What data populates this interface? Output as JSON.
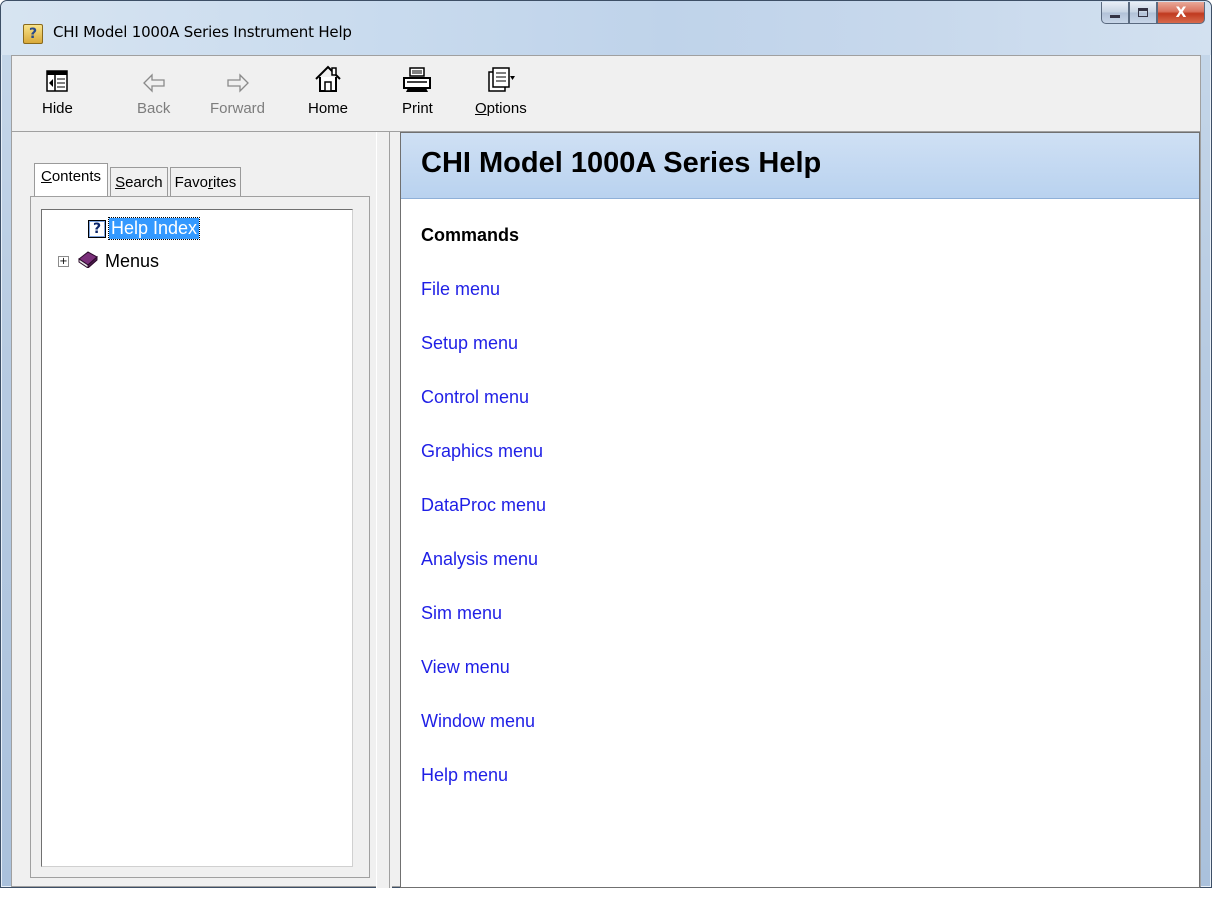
{
  "window": {
    "title": "CHI Model 1000A Series Instrument Help",
    "title_icon": "help-book-icon",
    "caption_buttons": [
      "minimize",
      "maximize",
      "close"
    ],
    "close_glyph": "X"
  },
  "toolbar": {
    "items": [
      {
        "label": "Hide",
        "icon": "hide-pane-icon",
        "enabled": true
      },
      {
        "label": "Back",
        "icon": "back-arrow-icon",
        "enabled": false
      },
      {
        "label": "Forward",
        "icon": "forward-arrow-icon",
        "enabled": false
      },
      {
        "label": "Home",
        "icon": "home-icon",
        "enabled": true
      },
      {
        "label": "Print",
        "icon": "printer-icon",
        "enabled": true
      },
      {
        "label": "Options",
        "icon": "options-icon",
        "enabled": true
      }
    ]
  },
  "nav": {
    "tabs": [
      {
        "label_pre": "",
        "accel": "C",
        "label_post": "ontents",
        "active": true
      },
      {
        "label_pre": "",
        "accel": "S",
        "label_post": "earch",
        "active": false
      },
      {
        "label_pre": "Favo",
        "accel": "r",
        "label_post": "ites",
        "active": false
      }
    ],
    "tree": [
      {
        "label": "Help Index",
        "icon": "question-page-icon",
        "selected": true
      },
      {
        "label": "Menus",
        "icon": "book-icon",
        "expander": "+",
        "selected": false
      }
    ]
  },
  "content": {
    "header": "CHI Model 1000A Series Help",
    "section_title": "Commands",
    "links": [
      "File menu",
      "Setup menu",
      "Control menu",
      "Graphics menu",
      "DataProc menu",
      "Analysis menu",
      "Sim menu",
      "View menu",
      "Window menu",
      "Help menu"
    ]
  },
  "colors": {
    "link": "#1f1fe6",
    "header_bg": "#c2d8f1",
    "selection": "#3399ff"
  }
}
